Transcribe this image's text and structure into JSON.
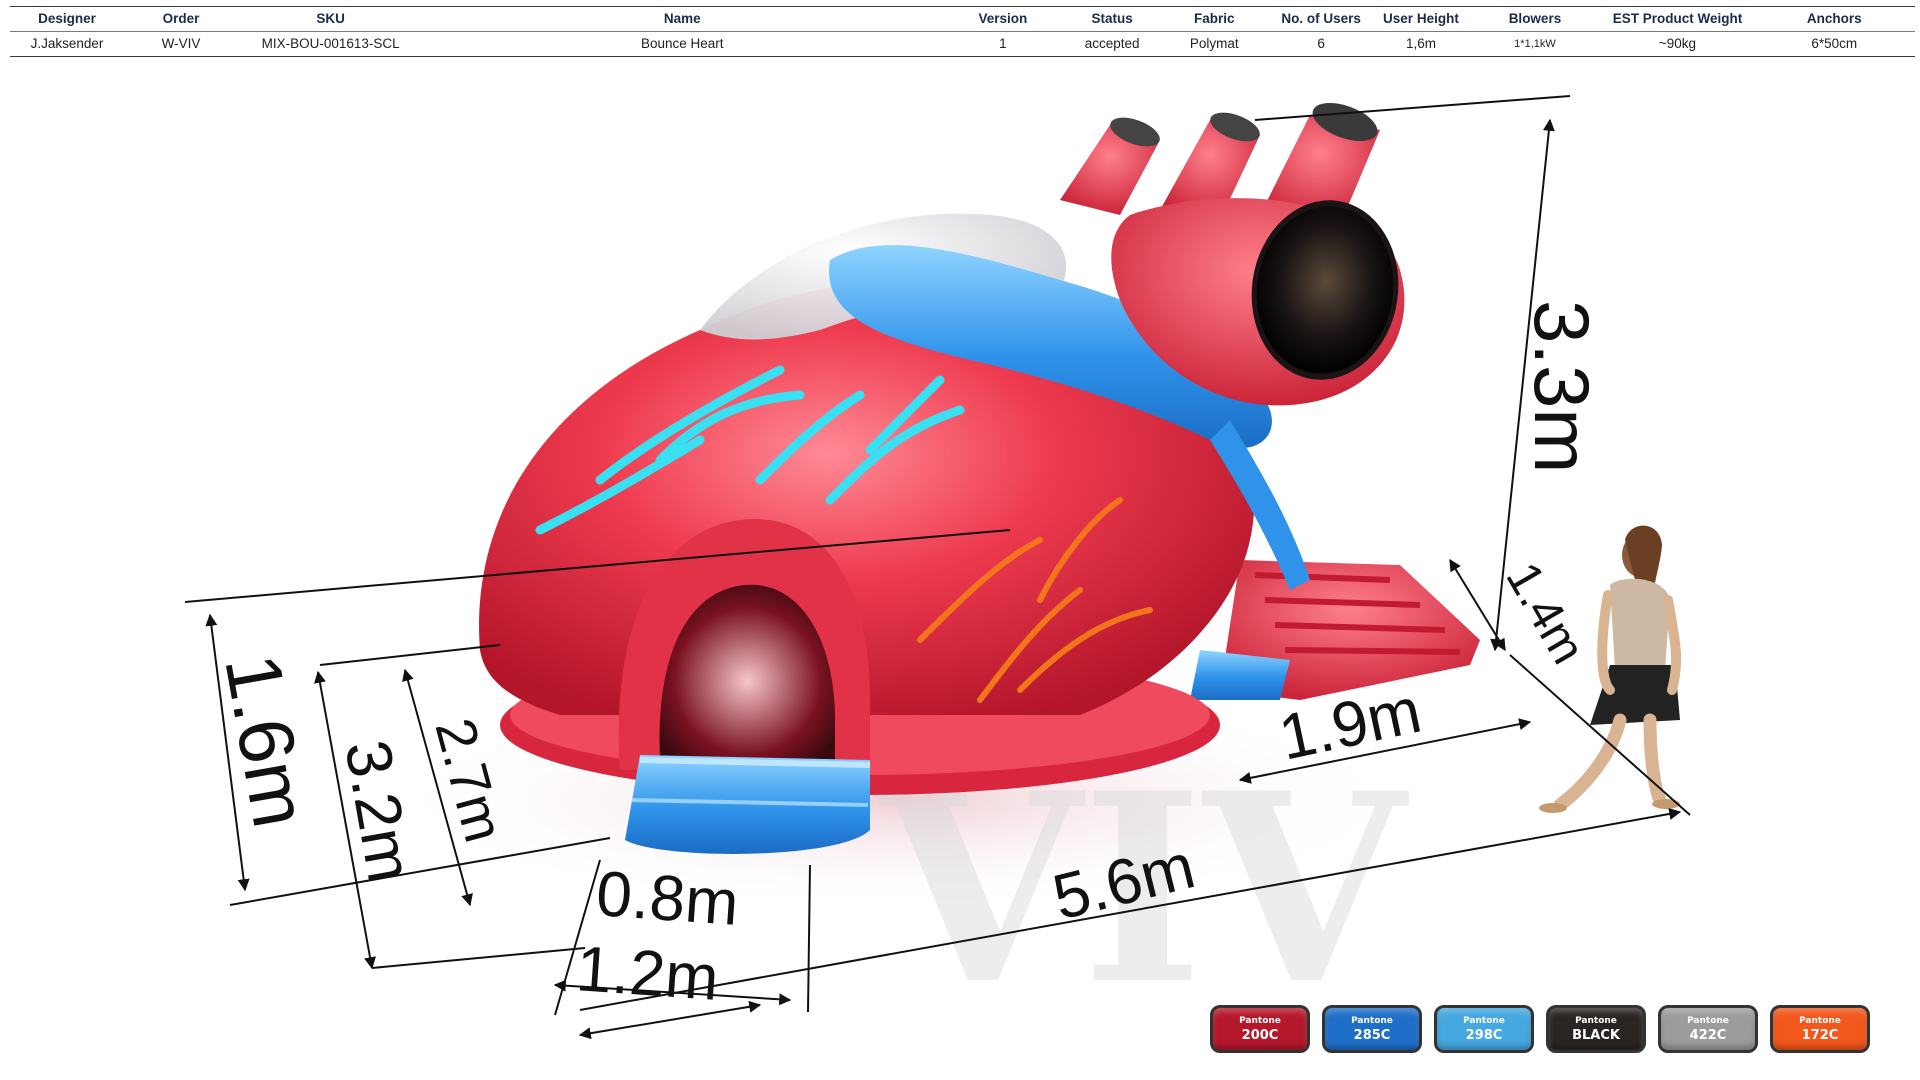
{
  "spec_table": {
    "headers": [
      "Designer",
      "Order",
      "SKU",
      "Name",
      "Version",
      "Status",
      "Fabric",
      "No. of Users",
      "User  Height",
      "Blowers",
      "EST Product Weight",
      "Anchors"
    ],
    "row": [
      "J.Jaksender",
      "W-VIV",
      "MIX-BOU-001613-SCL",
      "Bounce Heart",
      "1",
      "accepted",
      "Polymat",
      "6",
      "1,6m",
      "1*1,1kW",
      "~90kg",
      "6*50cm"
    ]
  },
  "dimensions": {
    "height_total": "3.3m",
    "slide_width": "1.4m",
    "slide_length": "1.9m",
    "length_total": "5.6m",
    "person_height": "1.6m",
    "width_total": "3.2m",
    "width_inner": "2.7m",
    "entrance_inner": "0.8m",
    "entrance_outer": "1.2m"
  },
  "watermark": "VIV",
  "swatches": [
    {
      "brand": "Pantone",
      "code": "200C",
      "color": "#b5172b"
    },
    {
      "brand": "Pantone",
      "code": "285C",
      "color": "#1f6fc9"
    },
    {
      "brand": "Pantone",
      "code": "298C",
      "color": "#45a8e0"
    },
    {
      "brand": "Pantone",
      "code": "BLACK",
      "color": "#2a2522"
    },
    {
      "brand": "Pantone",
      "code": "422C",
      "color": "#9c9c9c"
    },
    {
      "brand": "Pantone",
      "code": "172C",
      "color": "#f2571b"
    }
  ]
}
